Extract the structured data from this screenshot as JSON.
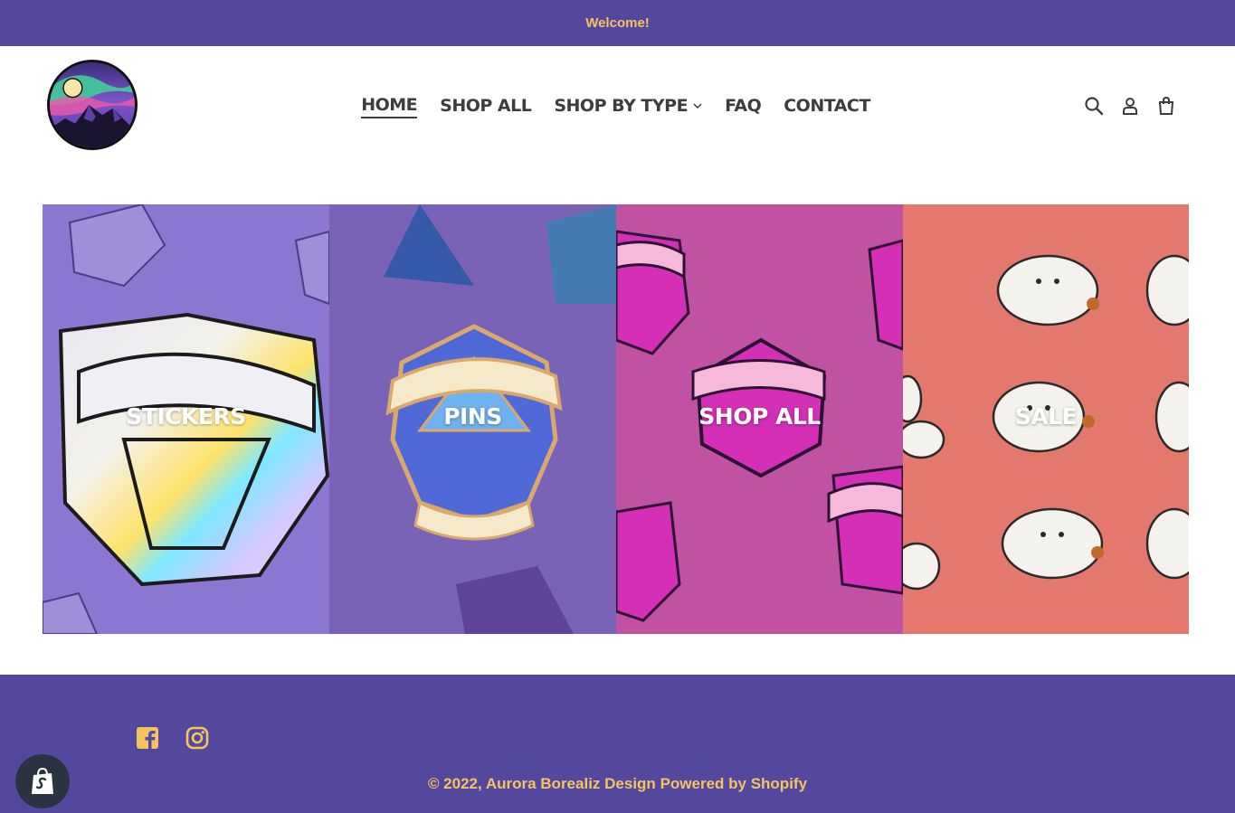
{
  "announcement": {
    "text": "Welcome!"
  },
  "header": {
    "logo_alt": "Aurora Borealiz Design logo",
    "nav": [
      {
        "label": "HOME",
        "active": true
      },
      {
        "label": "SHOP ALL"
      },
      {
        "label": "SHOP BY TYPE",
        "has_dropdown": true
      },
      {
        "label": "FAQ"
      },
      {
        "label": "CONTACT"
      }
    ],
    "icons": [
      "search-icon",
      "account-icon",
      "cart-icon"
    ]
  },
  "collections": [
    {
      "label": "STICKERS"
    },
    {
      "label": "PINS"
    },
    {
      "label": "SHOP ALL"
    },
    {
      "label": "SALE"
    }
  ],
  "footer": {
    "social": [
      "facebook-icon",
      "instagram-icon"
    ],
    "copyright_prefix": "© 2022, ",
    "store_name": "Aurora Borealiz Design",
    "powered_by": "Powered by Shopify"
  },
  "colors": {
    "brand_purple": "#54489e",
    "accent_gold": "#f7c35f",
    "text_dark": "#3d3d3d"
  }
}
